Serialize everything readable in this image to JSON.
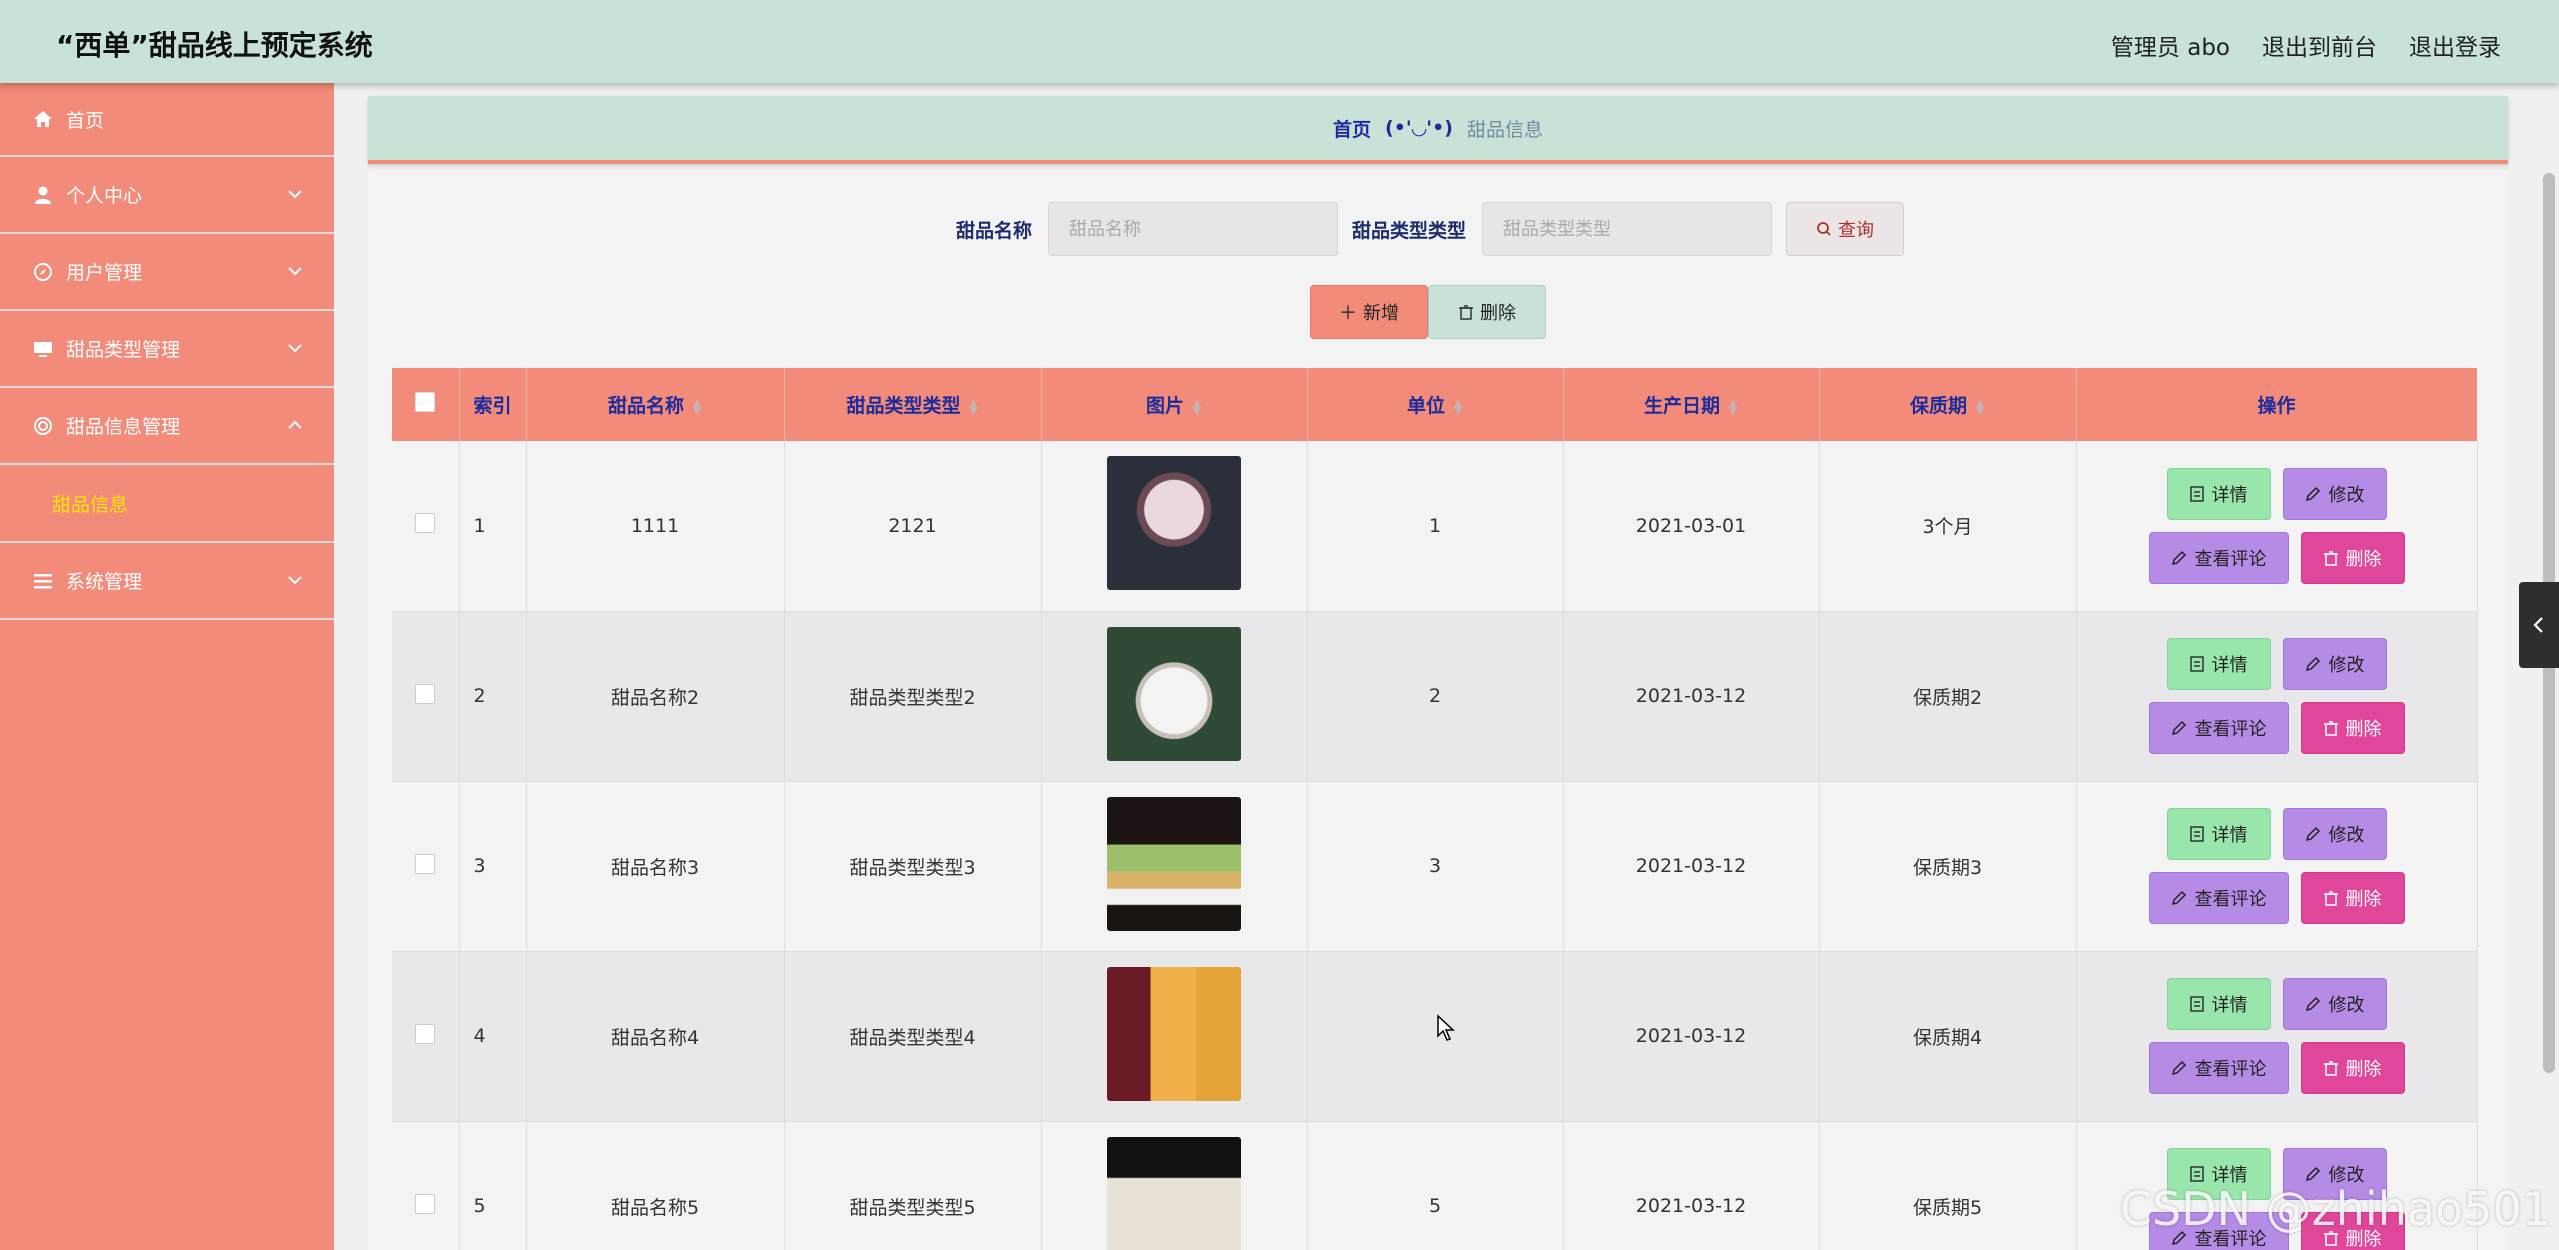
{
  "header": {
    "title": "“西单”甜品线上预定系统",
    "user_label": "管理员 abo",
    "front_link": "退出到前台",
    "logout_link": "退出登录"
  },
  "sidebar": {
    "items": [
      {
        "label": "首页",
        "icon": "home-icon"
      },
      {
        "label": "个人中心",
        "icon": "user-icon"
      },
      {
        "label": "用户管理",
        "icon": "compass-icon"
      },
      {
        "label": "甜品类型管理",
        "icon": "monitor-icon"
      },
      {
        "label": "甜品信息管理",
        "icon": "settings-circle-icon"
      },
      {
        "label": "系统管理",
        "icon": "list-icon"
      }
    ],
    "active_sub": "甜品信息"
  },
  "breadcrumb": {
    "home": "首页",
    "face": "(•'◡'•)",
    "current": "甜品信息"
  },
  "search": {
    "name_label": "甜品名称",
    "name_placeholder": "甜品名称",
    "type_label": "甜品类型类型",
    "type_placeholder": "甜品类型类型",
    "query_label": "查询"
  },
  "actions": {
    "add_label": "新增",
    "delete_label": "删除"
  },
  "table": {
    "headers": {
      "index": "索引",
      "name": "甜品名称",
      "type": "甜品类型类型",
      "image": "图片",
      "unit": "单位",
      "date": "生产日期",
      "shelf": "保质期",
      "ops": "操作"
    },
    "rows": [
      {
        "index": "1",
        "name": "1111",
        "type": "2121",
        "unit": "1",
        "date": "2021-03-01",
        "shelf": "3个月"
      },
      {
        "index": "2",
        "name": "甜品名称2",
        "type": "甜品类型类型2",
        "unit": "2",
        "date": "2021-03-12",
        "shelf": "保质期2"
      },
      {
        "index": "3",
        "name": "甜品名称3",
        "type": "甜品类型类型3",
        "unit": "3",
        "date": "2021-03-12",
        "shelf": "保质期3"
      },
      {
        "index": "4",
        "name": "甜品名称4",
        "type": "甜品类型类型4",
        "unit": "",
        "date": "2021-03-12",
        "shelf": "保质期4"
      },
      {
        "index": "5",
        "name": "甜品名称5",
        "type": "甜品类型类型5",
        "unit": "5",
        "date": "2021-03-12",
        "shelf": "保质期5"
      }
    ],
    "buttons": {
      "detail": "详情",
      "edit": "修改",
      "review": "查看评论",
      "delete": "删除"
    }
  },
  "watermark": "CSDN @zhihao501",
  "colors": {
    "accent": "#f28b79",
    "mint": "#c9e2d8",
    "detail_btn": "#99e6ad",
    "edit_btn": "#b58be6",
    "delete_btn": "#e0479b",
    "active_sub": "#ffe600"
  }
}
